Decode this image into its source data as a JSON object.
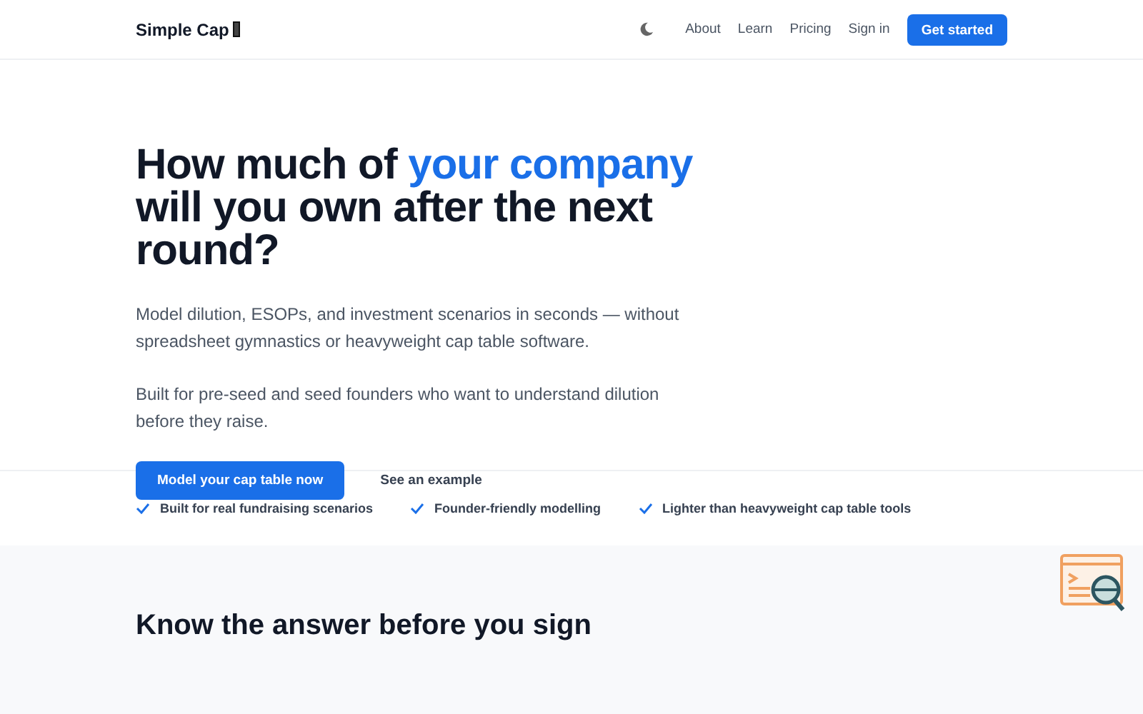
{
  "nav": {
    "brand": "Simple Cap",
    "links": [
      "About",
      "Learn",
      "Pricing",
      "Sign in"
    ],
    "cta": "Get started"
  },
  "hero": {
    "headline_before": "How much of ",
    "headline_highlight": "your company",
    "headline_after": " will you own after the next round?",
    "paragraphs": [
      "Model dilution, ESOPs, and investment scenarios in seconds — without spreadsheet gymnastics or heavyweight cap table software.",
      "Built for pre-seed and seed founders who want to understand dilution before they raise."
    ],
    "primary_button": "Model your cap table now",
    "secondary_button": "See an example"
  },
  "features": [
    "Built for real fundraising scenarios",
    "Founder-friendly modelling",
    "Lighter than heavyweight cap table tools"
  ],
  "next_section": {
    "heading": "Know the answer before you sign"
  }
}
